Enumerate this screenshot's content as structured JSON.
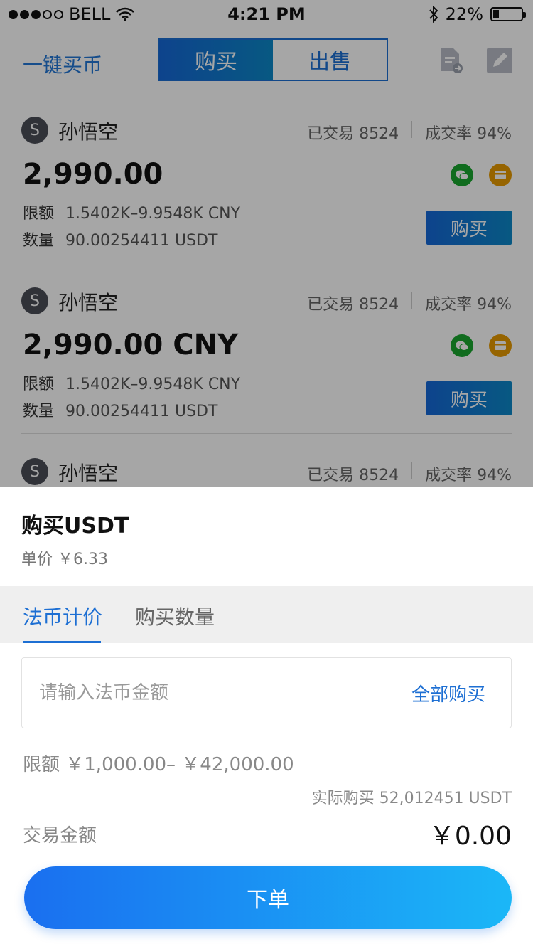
{
  "status_bar": {
    "carrier": "BELL",
    "time": "4:21 PM",
    "battery": "22%",
    "battery_level": 0.22
  },
  "header": {
    "quick_buy": "一键买币",
    "segments": [
      {
        "label": "购买",
        "active": true
      },
      {
        "label": "出售",
        "active": false
      }
    ],
    "icons": [
      "document-transfer-icon",
      "edit-icon"
    ]
  },
  "offers": [
    {
      "avatar": "S",
      "name": "孙悟空",
      "traded": "已交易 8524",
      "rate": "成交率 94%",
      "price": "2,990.00",
      "limit_label": "限额",
      "limit": "1.5402K–9.9548K CNY",
      "qty_label": "数量",
      "qty": "90.00254411 USDT",
      "buy": "购买"
    },
    {
      "avatar": "S",
      "name": "孙悟空",
      "traded": "已交易 8524",
      "rate": "成交率 94%",
      "price": "2,990.00 CNY",
      "limit_label": "限额",
      "limit": "1.5402K–9.9548K CNY",
      "qty_label": "数量",
      "qty": "90.00254411 USDT",
      "buy": "购买"
    },
    {
      "avatar": "S",
      "name": "孙悟空",
      "traded": "已交易 8524",
      "rate": "成交率 94%"
    }
  ],
  "sheet": {
    "title": "购买USDT",
    "unit_price": "单价 ￥6.33",
    "tabs": [
      {
        "label": "法币计价",
        "active": true
      },
      {
        "label": "购买数量",
        "active": false
      }
    ],
    "input_placeholder": "请输入法币金额",
    "buy_all": "全部购买",
    "limit": "限额 ￥1,000.00– ￥42,000.00",
    "actual": "实际购买 52,012451 USDT",
    "amount_label": "交易金额",
    "amount": "￥0.00",
    "order_button": "下单"
  },
  "colors": {
    "accent": "#1d6fd3",
    "wechat": "#1aa62e",
    "card": "#e69a00"
  }
}
